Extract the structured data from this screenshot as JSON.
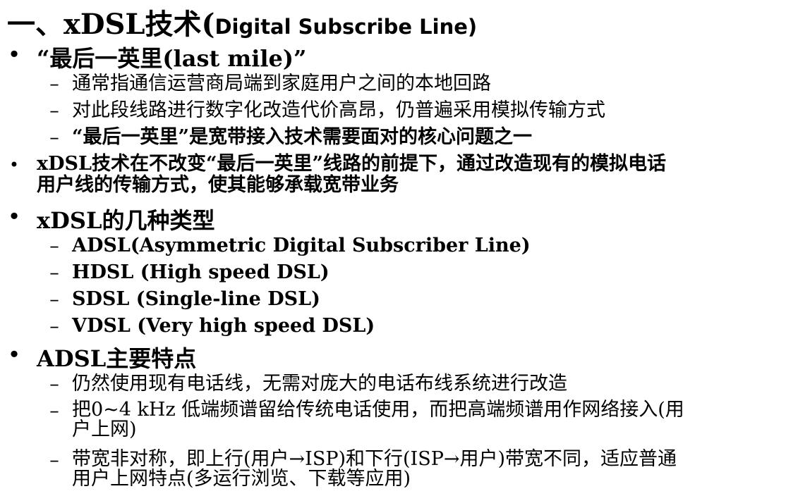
{
  "title": {
    "main": "一、xDSL技术(",
    "paren": "Digital Subscribe Line)"
  },
  "markers": {
    "bullet": "•",
    "dash": "–"
  },
  "sections": [
    {
      "text": "“最后一英里(last mile)”",
      "subs": [
        "通常指通信运营商局端到家庭用户之间的本地回路",
        "对此段线路进行数字化改造代价高昂，仍普遍采用模拟传输方式",
        "“最后一英里”是宽带接入技术需要面对的核心问题之一"
      ]
    },
    {
      "lines": [
        "xDSL技术在不改变“最后一英里”线路的前提下，通过改造现有的模拟电话",
        "用户线的传输方式，使其能够承载宽带业务"
      ]
    },
    {
      "text": "xDSL的几种类型",
      "subs": [
        "ADSL(Asymmetric Digital Subscriber Line)",
        "HDSL (High speed DSL)",
        "SDSL (Single-line DSL)",
        "VDSL (Very high speed DSL)"
      ]
    },
    {
      "text": "ADSL主要特点",
      "subs": [
        [
          "仍然使用现有电话线，无需对庞大的电话布线系统进行改造"
        ],
        [
          "把0~4 kHz 低端频谱留给传统电话使用，而把高端频谱用作网络接入(用",
          "户上网)"
        ],
        [
          "带宽非对称，即上行(用户→ISP)和下行(ISP→用户)带宽不同，适应普通",
          "用户上网特点(多运行浏览、下载等应用)"
        ]
      ]
    }
  ]
}
